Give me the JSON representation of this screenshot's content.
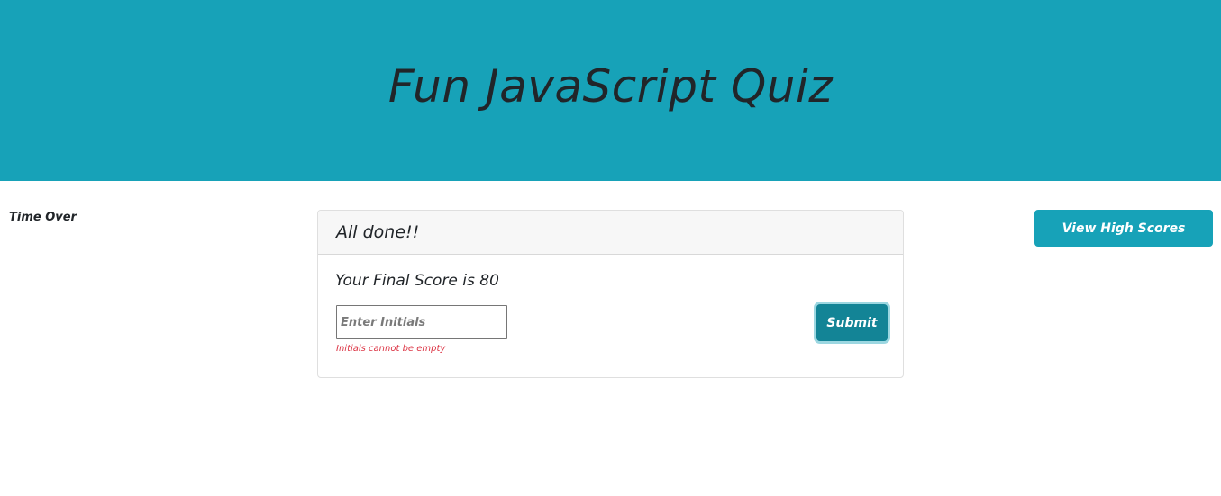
{
  "header": {
    "title": "Fun JavaScript Quiz",
    "background_color": "#17a2b8"
  },
  "timer": {
    "text": "Time Over"
  },
  "nav": {
    "view_high_scores_label": "View High Scores"
  },
  "result_card": {
    "heading": "All done!!",
    "score_text": "Your Final Score is 80",
    "initials_input": {
      "value": "",
      "placeholder": "Enter Initials"
    },
    "error_text": "Initials cannot be empty",
    "submit_label": "Submit",
    "submit_color": "#138496",
    "error_color": "#dc3545"
  }
}
